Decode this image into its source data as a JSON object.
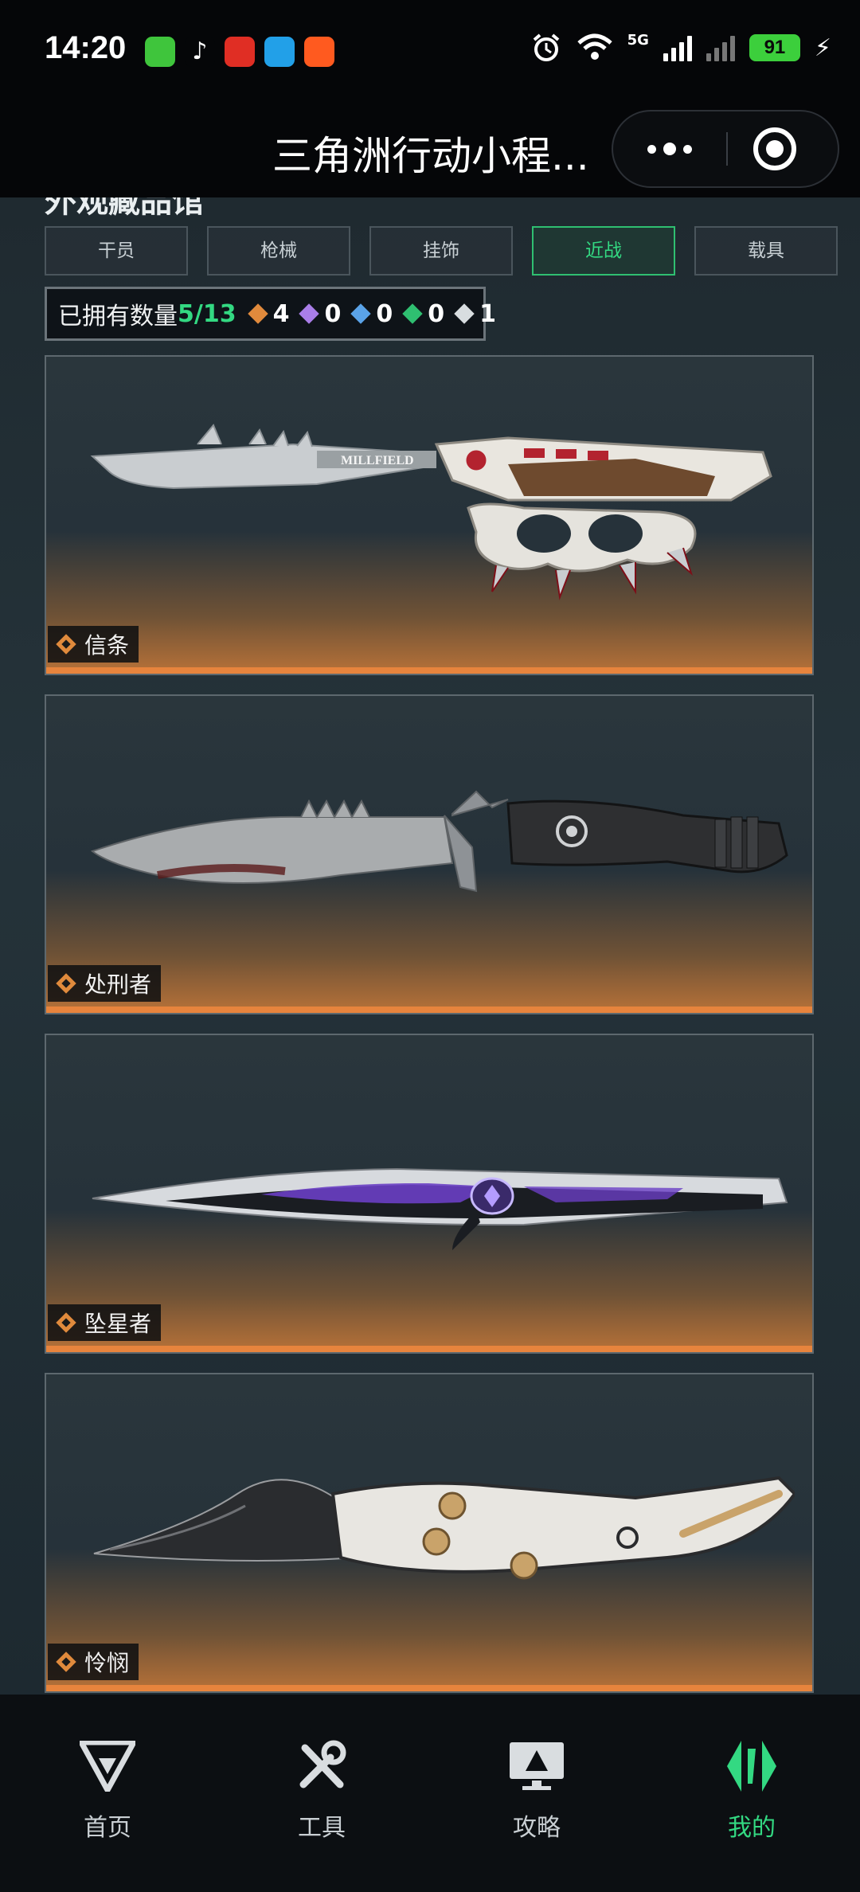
{
  "status_bar": {
    "time": "14:20",
    "network": "5G",
    "battery": "91",
    "icons": [
      "messages-icon",
      "tiktok-icon",
      "pinduoduo-icon",
      "video-app-icon",
      "kuaishou-icon",
      "alarm-icon",
      "wifi-icon",
      "signal-icon",
      "charging-icon"
    ]
  },
  "title_bar": {
    "title": "三角洲行动小程..."
  },
  "section": {
    "title": "外观藏品馆"
  },
  "tabs": [
    {
      "label": "干员",
      "active": false
    },
    {
      "label": "枪械",
      "active": false
    },
    {
      "label": "挂饰",
      "active": false
    },
    {
      "label": "近战",
      "active": true
    },
    {
      "label": "载具",
      "active": false
    }
  ],
  "owned": {
    "label": "已拥有数量",
    "count": "5/13",
    "rarity_counts": [
      {
        "color": "orange",
        "value": "4"
      },
      {
        "color": "purple",
        "value": "0"
      },
      {
        "color": "blue",
        "value": "0"
      },
      {
        "color": "green",
        "value": "0"
      },
      {
        "color": "white",
        "value": "1"
      }
    ]
  },
  "items": [
    {
      "name": "信条",
      "engraving": "MILLFIELD"
    },
    {
      "name": "处刑者",
      "engraving": ""
    },
    {
      "name": "坠星者",
      "engraving": ""
    },
    {
      "name": "怜悯",
      "engraving": ""
    }
  ],
  "bottom_nav": [
    {
      "label": "首页",
      "icon": "home-logo-icon",
      "active": false
    },
    {
      "label": "工具",
      "icon": "tools-icon",
      "active": false
    },
    {
      "label": "攻略",
      "icon": "guide-monitor-icon",
      "active": false
    },
    {
      "label": "我的",
      "icon": "profile-logo-icon",
      "active": true
    }
  ],
  "colors": {
    "accent_green": "#33d982",
    "rarity_orange": "#e08a3c",
    "card_bottom_glow": "#e7843d"
  }
}
